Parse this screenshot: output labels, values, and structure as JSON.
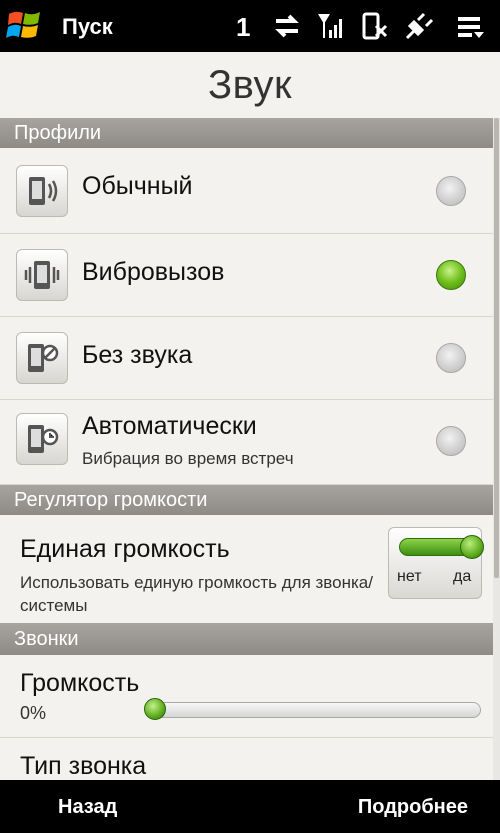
{
  "statusbar": {
    "start_label": "Пуск",
    "number": "1"
  },
  "title": "Звук",
  "sections": {
    "profiles": "Профили",
    "volume": "Регулятор громкости",
    "calls": "Звонки"
  },
  "profiles": [
    {
      "label": "Обычный",
      "sub": "",
      "selected": false,
      "icon": "phone-sound-icon"
    },
    {
      "label": "Вибровызов",
      "sub": "",
      "selected": true,
      "icon": "phone-vibrate-icon"
    },
    {
      "label": "Без звука",
      "sub": "",
      "selected": false,
      "icon": "phone-mute-icon"
    },
    {
      "label": "Автоматически",
      "sub": "Вибрация во время встреч",
      "selected": false,
      "icon": "phone-clock-icon"
    }
  ],
  "unified_volume": {
    "title": "Единая громкость",
    "description": "Использовать единую громкость для звонка/системы",
    "off_label": "нет",
    "on_label": "да",
    "enabled": true
  },
  "calls": {
    "volume_title": "Громкость",
    "volume_value": "0%",
    "volume_fraction": 0,
    "ringtone_title": "Тип звонка"
  },
  "softkeys": {
    "left": "Назад",
    "right": "Подробнее"
  },
  "colors": {
    "accent_green": "#5cab1c",
    "section_header": "#9b9893",
    "background": "#f4f2ee"
  }
}
